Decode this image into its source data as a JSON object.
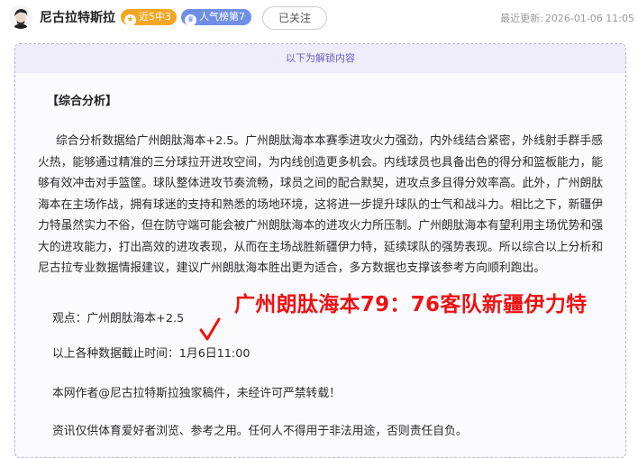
{
  "header": {
    "author_name": "尼古拉特斯拉",
    "badge_streak": "近5中3",
    "badge_rank": "人气榜第7",
    "follow_label": "已关注",
    "update_label": "最近更新:",
    "update_time": "2026-01-06 11:05"
  },
  "unlock": {
    "title": "以下为解锁内容"
  },
  "article": {
    "section_title": "【综合分析】",
    "analysis": "综合分析数据给广州朗肽海本+2.5。广州朗肽海本本赛季进攻火力强劲，内外线结合紧密，外线射手群手感火热，能够通过精准的三分球拉开进攻空间，为内线创造更多机会。内线球员也具备出色的得分和篮板能力，能够有效冲击对手篮筐。球队整体进攻节奏流畅，球员之间的配合默契，进攻点多且得分效率高。此外，广州朗肽海本在主场作战，拥有球迷的支持和熟悉的场地环境，这将进一步提升球队的士气和战斗力。相比之下，新疆伊力特虽然实力不俗，但在防守端可能会被广州朗肽海本的进攻火力所压制。广州朗肽海本有望利用主场优势和强大的进攻能力，打出高效的进攻表现，从而在主场战胜新疆伊力特，延续球队的强势表现。所以综合以上分析和尼古拉专业数据情报建议，建议广州朗肽海本胜出更为适合，多方数据也支撑该参考方向顺利跑出。",
    "viewpoint": "观点：广州朗肽海本+2.5",
    "deadline_label": "以上各种数据截止时间：",
    "deadline_time": "1月6日11:00",
    "copyright": "本网作者@尼古拉特斯拉独家稿件，未经许可严禁转载！",
    "disclaimer": "资讯仅供体育爱好者浏览、参考之用。任何人不得用于非法用途，否则责任自负。"
  },
  "overlay": {
    "result_text": "广州朗肽海本79：76客队新疆伊力特",
    "result_color": "#ee1111"
  },
  "icons": {
    "avatar": "author-avatar",
    "streak": "star-icon",
    "rank": "crown-icon",
    "check": "checkmark-icon"
  }
}
